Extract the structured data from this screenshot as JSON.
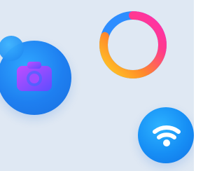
{
  "icons": {
    "camera": "camera-icon",
    "ring": "progress-ring-icon",
    "wifi": "wifi-icon"
  },
  "colors": {
    "background": "#dfe8f3",
    "bubble_blue": "#1e7ff0",
    "camera_gradient_start": "#b04dff",
    "camera_gradient_end": "#5d4dff",
    "ring_gradient": [
      "#ffcf24",
      "#ff8a2a",
      "#ff3b8b",
      "#2d8dff"
    ]
  }
}
